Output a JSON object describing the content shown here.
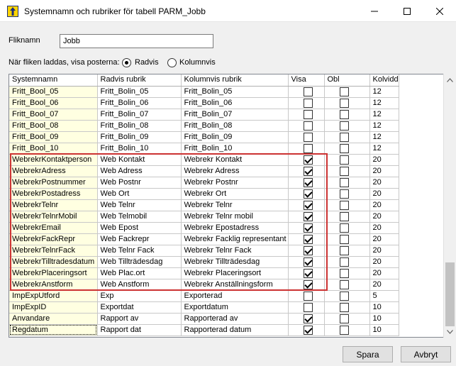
{
  "window": {
    "title": "Systemnamn och rubriker för tabell PARM_Jobb",
    "minimize_glyph": "—",
    "maximize_glyph": "☐",
    "close_glyph": "✕"
  },
  "form": {
    "fliknamn_label": "Fliknamn",
    "fliknamn_value": "Jobb",
    "load_label": "När fliken laddas, visa posterna:",
    "radio_radvis": "Radvis",
    "radio_kolumnvis": "Kolumnvis",
    "selected": "Radvis"
  },
  "grid": {
    "columns": [
      "Systemnamn",
      "Radvis rubrik",
      "Kolumnvis rubrik",
      "Visa",
      "Obl",
      "Kolvidd"
    ],
    "rows": [
      {
        "sys": "Fritt_Bool_05",
        "rad": "Fritt_Bolin_05",
        "kol": "Fritt_Bolin_05",
        "visa": false,
        "obl": false,
        "w": "12"
      },
      {
        "sys": "Fritt_Bool_06",
        "rad": "Fritt_Bolin_06",
        "kol": "Fritt_Bolin_06",
        "visa": false,
        "obl": false,
        "w": "12"
      },
      {
        "sys": "Fritt_Bool_07",
        "rad": "Fritt_Bolin_07",
        "kol": "Fritt_Bolin_07",
        "visa": false,
        "obl": false,
        "w": "12"
      },
      {
        "sys": "Fritt_Bool_08",
        "rad": "Fritt_Bolin_08",
        "kol": "Fritt_Bolin_08",
        "visa": false,
        "obl": false,
        "w": "12"
      },
      {
        "sys": "Fritt_Bool_09",
        "rad": "Fritt_Bolin_09",
        "kol": "Fritt_Bolin_09",
        "visa": false,
        "obl": false,
        "w": "12"
      },
      {
        "sys": "Fritt_Bool_10",
        "rad": "Fritt_Bolin_10",
        "kol": "Fritt_Bolin_10",
        "visa": false,
        "obl": false,
        "w": "12"
      },
      {
        "sys": "WebrekrKontaktperson",
        "rad": "Web Kontakt",
        "kol": "Webrekr Kontakt",
        "visa": true,
        "obl": false,
        "w": "20"
      },
      {
        "sys": "WebrekrAdress",
        "rad": "Web Adress",
        "kol": "Webrekr Adress",
        "visa": true,
        "obl": false,
        "w": "20"
      },
      {
        "sys": "WebrekrPostnummer",
        "rad": "Web Postnr",
        "kol": "Webrekr Postnr",
        "visa": true,
        "obl": false,
        "w": "20"
      },
      {
        "sys": "WebrekrPostadress",
        "rad": "Web Ort",
        "kol": "Webrekr Ort",
        "visa": true,
        "obl": false,
        "w": "20"
      },
      {
        "sys": "WebrekrTelnr",
        "rad": "Web Telnr",
        "kol": "Webrekr Telnr",
        "visa": true,
        "obl": false,
        "w": "20"
      },
      {
        "sys": "WebrekrTelnrMobil",
        "rad": "Web Telmobil",
        "kol": "Webrekr Telnr mobil",
        "visa": true,
        "obl": false,
        "w": "20"
      },
      {
        "sys": "WebrekrEmail",
        "rad": "Web Epost",
        "kol": "Webrekr Epostadress",
        "visa": true,
        "obl": false,
        "w": "20"
      },
      {
        "sys": "WebrekrFackRepr",
        "rad": "Web Fackrepr",
        "kol": "Webrekr Facklig representant",
        "visa": true,
        "obl": false,
        "w": "20"
      },
      {
        "sys": "WebrekrTelnrFack",
        "rad": "Web Telnr Fack",
        "kol": "Webrekr Telnr Fack",
        "visa": true,
        "obl": false,
        "w": "20"
      },
      {
        "sys": "WebrekrTilltradesdatum",
        "rad": "Web Tillträdesdag",
        "kol": "Webrekr Tillträdesdag",
        "visa": true,
        "obl": false,
        "w": "20"
      },
      {
        "sys": "WebrekrPlaceringsort",
        "rad": "Web Plac.ort",
        "kol": "Webrekr Placeringsort",
        "visa": true,
        "obl": false,
        "w": "20"
      },
      {
        "sys": "WebrekrAnstform",
        "rad": "Web Anstform",
        "kol": "Webrekr Anställningsform",
        "visa": true,
        "obl": false,
        "w": "20"
      },
      {
        "sys": "ImpExpUtford",
        "rad": "Exp",
        "kol": "Exporterad",
        "visa": false,
        "obl": false,
        "w": "5"
      },
      {
        "sys": "ImpExpID",
        "rad": "Exportdat",
        "kol": "Exportdatum",
        "visa": false,
        "obl": false,
        "w": "10"
      },
      {
        "sys": "Anvandare",
        "rad": "Rapport av",
        "kol": "Rapporterad av",
        "visa": true,
        "obl": false,
        "w": "10"
      },
      {
        "sys": "Regdatum",
        "rad": "Rapport dat",
        "kol": "Rapporterad datum",
        "visa": true,
        "obl": false,
        "w": "10"
      }
    ]
  },
  "buttons": {
    "save": "Spara",
    "cancel": "Avbryt"
  },
  "colors": {
    "highlight_box": "#cc3333",
    "sysname_cell": "#ffffe1"
  }
}
